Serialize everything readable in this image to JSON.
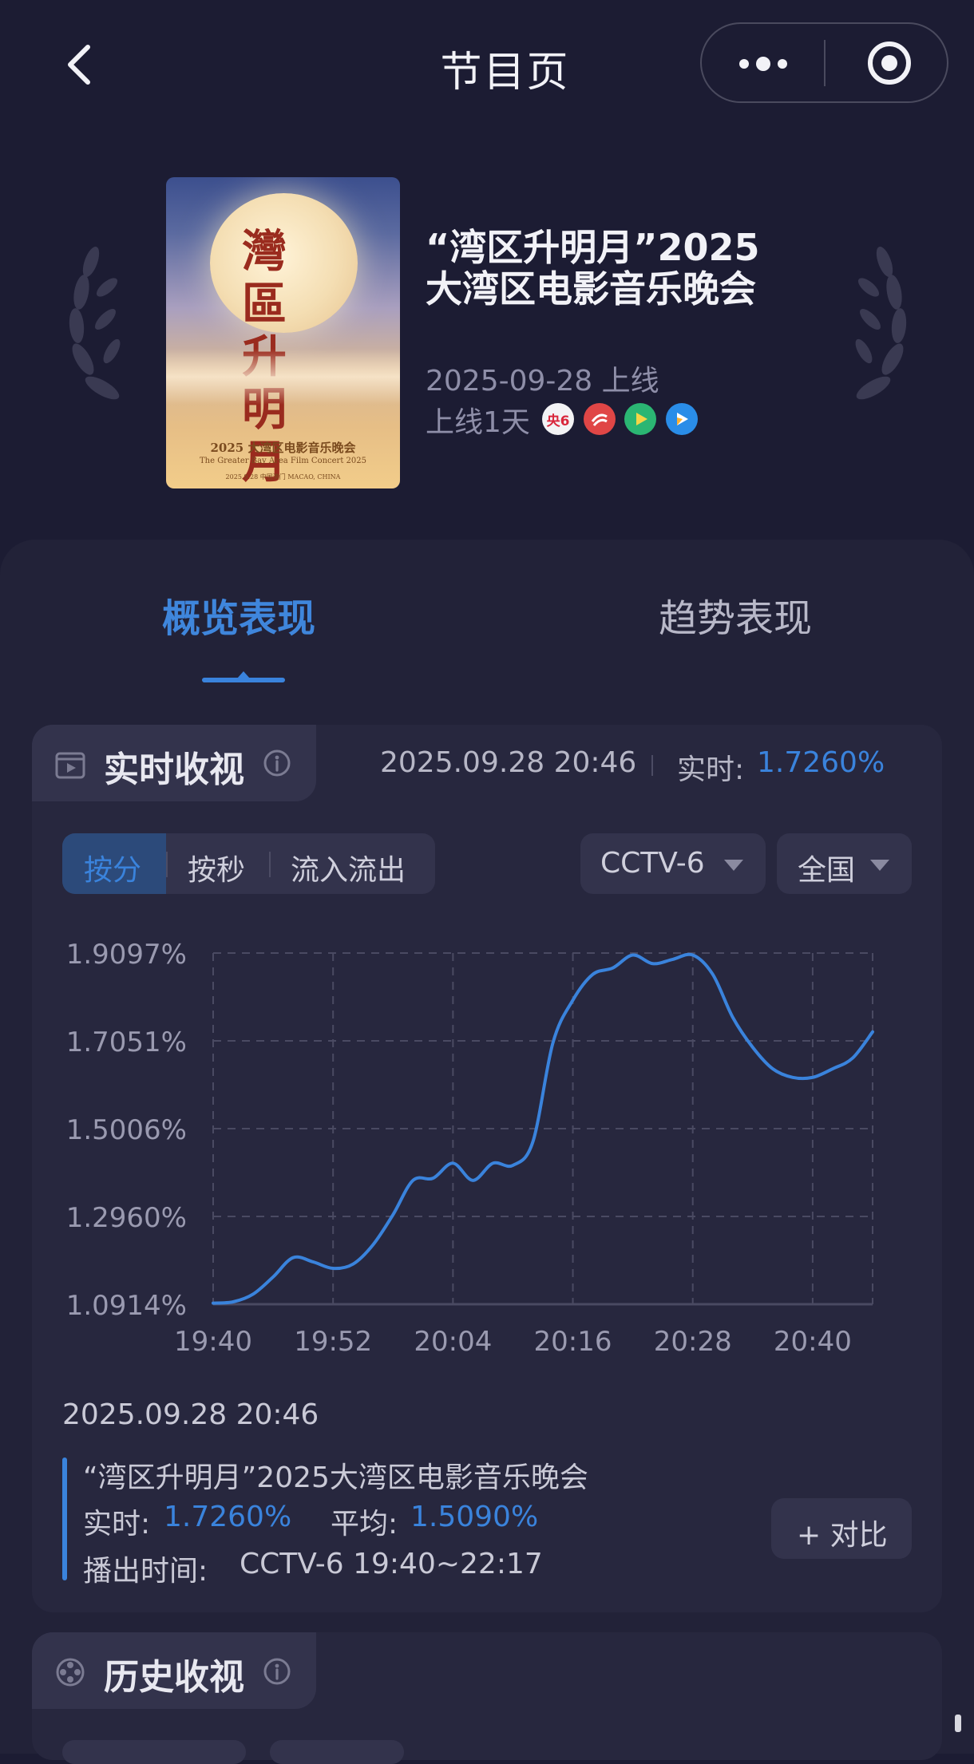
{
  "header": {
    "title": "节目页",
    "back_icon": "chevron-left-icon",
    "more_icon": "more-dots-icon",
    "close_icon": "target-icon"
  },
  "program": {
    "title_line1": "“湾区升明月”2025",
    "title_line2": "大湾区电影音乐晚会",
    "release": "2025-09-28 上线",
    "online_days": "上线1天",
    "channels": [
      {
        "name": "CCTV-6",
        "badge": "央6",
        "color": "#d9263b"
      },
      {
        "name": "GDTV",
        "badge": "",
        "color": "#e04646"
      },
      {
        "name": "player",
        "badge": "",
        "color": "#2bb673"
      },
      {
        "name": "video",
        "badge": "",
        "color": "#2a8de8"
      }
    ],
    "poster": {
      "calligraphy": "灣區升明月",
      "title_cn": "2025 大湾区电影音乐晚会",
      "title_en": "The Greater Bay Area Film Concert 2025",
      "venue": "2025.9.28 中国澳门 MACAO, CHINA"
    }
  },
  "tabs": [
    {
      "label": "概览表现",
      "active": true
    },
    {
      "label": "趋势表现",
      "active": false
    }
  ],
  "realtime": {
    "title": "实时收视",
    "timestamp": "2025.09.28 20:46",
    "label": "实时:",
    "value": "1.7260%",
    "segments": [
      "按分",
      "按秒",
      "流入流出"
    ],
    "channel_select": "CCTV-6",
    "region_select": "全国"
  },
  "chart_data": {
    "type": "line",
    "x": [
      "19:40",
      "19:42",
      "19:44",
      "19:46",
      "19:48",
      "19:50",
      "19:52",
      "19:54",
      "19:56",
      "19:58",
      "20:00",
      "20:02",
      "20:04",
      "20:06",
      "20:08",
      "20:10",
      "20:12",
      "20:14",
      "20:16",
      "20:18",
      "20:20",
      "20:22",
      "20:24",
      "20:26",
      "20:28",
      "20:30",
      "20:32",
      "20:34",
      "20:36",
      "20:38",
      "20:40",
      "20:42",
      "20:44",
      "20:46"
    ],
    "series": [
      {
        "values": [
          1.094,
          1.097,
          1.115,
          1.155,
          1.2,
          1.19,
          1.175,
          1.185,
          1.23,
          1.3,
          1.38,
          1.385,
          1.42,
          1.38,
          1.42,
          1.415,
          1.47,
          1.7,
          1.8,
          1.86,
          1.875,
          1.905,
          1.885,
          1.895,
          1.905,
          1.86,
          1.76,
          1.69,
          1.64,
          1.62,
          1.62,
          1.64,
          1.665,
          1.726
        ],
        "color": "#3a83dc"
      }
    ],
    "y_ticks": [
      "1.9097%",
      "1.7051%",
      "1.5006%",
      "1.2960%",
      "1.0914%"
    ],
    "x_ticks": [
      "19:40",
      "19:52",
      "20:04",
      "20:16",
      "20:28",
      "20:40"
    ],
    "ylim": [
      1.0914,
      1.9097
    ],
    "grid": true
  },
  "detail": {
    "timestamp": "2025.09.28 20:46",
    "program": "“湾区升明月”2025大湾区电影音乐晚会",
    "realtime_label": "实时:",
    "realtime_value": "1.7260%",
    "average_label": "平均:",
    "average_value": "1.5090%",
    "airtime_label": "播出时间:",
    "airtime_value": "CCTV-6 19:40~22:17",
    "compare_button": "+ 对比"
  },
  "history": {
    "title": "历史收视"
  }
}
